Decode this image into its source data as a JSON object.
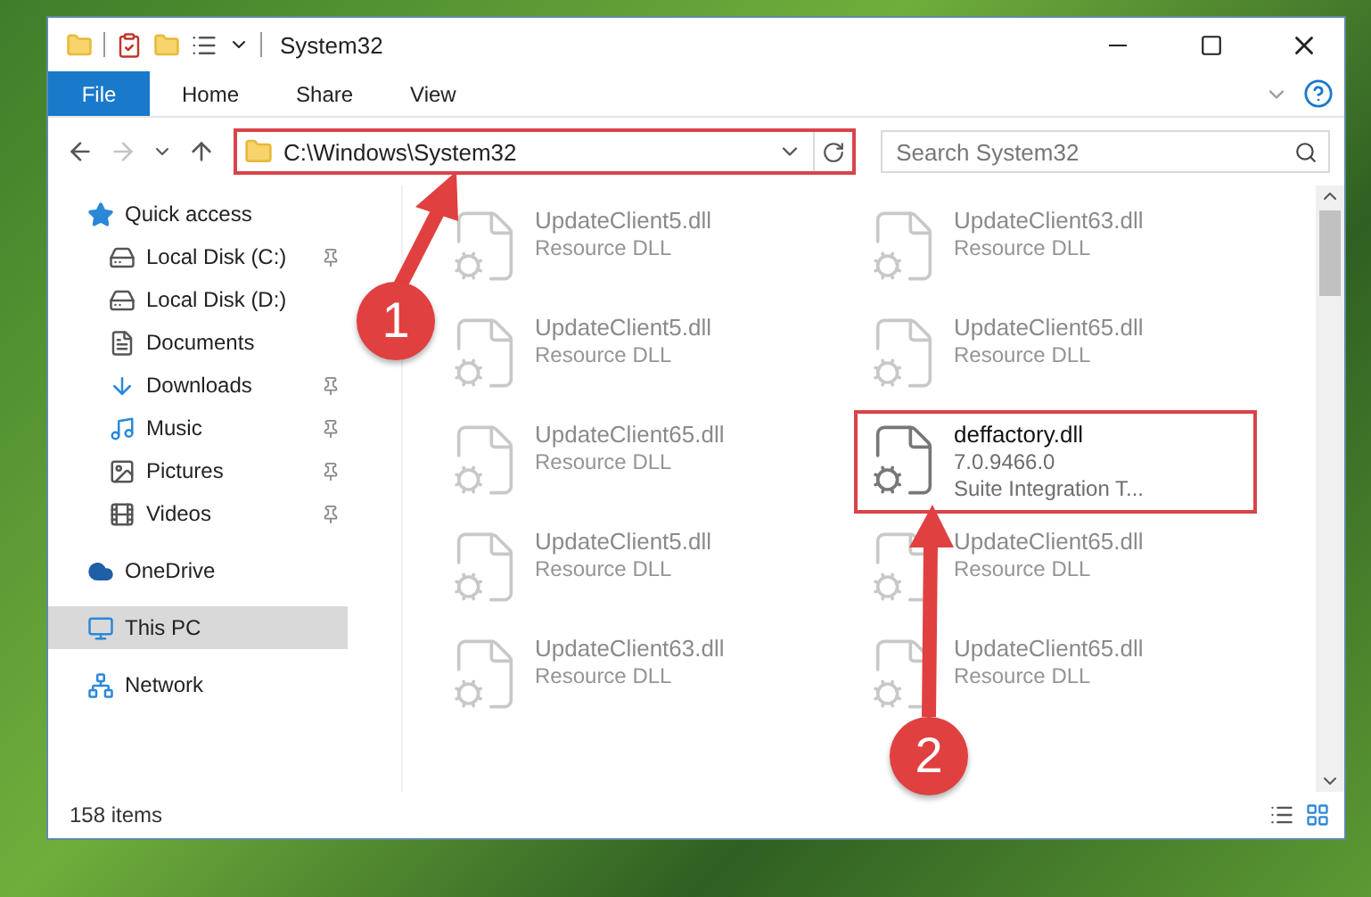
{
  "window": {
    "title": "System32"
  },
  "ribbon_tabs": [
    {
      "label": "File",
      "kind": "file"
    },
    {
      "label": "Home",
      "kind": "tab"
    },
    {
      "label": "Share",
      "kind": "tab"
    },
    {
      "label": "View",
      "kind": "tab"
    }
  ],
  "navigation": {
    "back_disabled": false,
    "forward_disabled": true
  },
  "address": {
    "path": "C:\\Windows\\System32",
    "highlighted": true
  },
  "search": {
    "placeholder": "Search System32"
  },
  "nav": {
    "items": [
      {
        "label": "Quick access",
        "selected": false,
        "children": [
          {
            "label": "Local Disk (C:)",
            "selected": false,
            "pinned": true
          },
          {
            "label": "Local Disk (D:)",
            "selected": false,
            "pinned": false
          },
          {
            "label": "Documents",
            "selected": false,
            "pinned": false
          },
          {
            "label": "Downloads",
            "selected": false,
            "pinned": true
          },
          {
            "label": "Music",
            "selected": false,
            "pinned": true
          },
          {
            "label": "Pictures",
            "selected": false,
            "pinned": true
          },
          {
            "label": "Videos",
            "selected": false,
            "pinned": true
          }
        ]
      },
      {
        "label": "OneDrive",
        "selected": false
      },
      {
        "label": "This PC",
        "selected": true
      },
      {
        "label": "Network",
        "selected": false
      }
    ]
  },
  "files": [
    {
      "name": "UpdateClient5.dll",
      "details": [
        "Resource DLL"
      ],
      "faded": true,
      "highlighted": false
    },
    {
      "name": "UpdateClient63.dll",
      "details": [
        "Resource DLL"
      ],
      "faded": true,
      "highlighted": false
    },
    {
      "name": "UpdateClient5.dll",
      "details": [
        "Resource DLL"
      ],
      "faded": true,
      "highlighted": false
    },
    {
      "name": "UpdateClient65.dll",
      "details": [
        "Resource DLL"
      ],
      "faded": true,
      "highlighted": false
    },
    {
      "name": "UpdateClient65.dll",
      "details": [
        "Resource DLL"
      ],
      "faded": true,
      "highlighted": false
    },
    {
      "name": "deffactory.dll",
      "details": [
        "7.0.9466.0",
        "Suite Integration T..."
      ],
      "faded": false,
      "highlighted": true
    },
    {
      "name": "UpdateClient5.dll",
      "details": [
        "Resource DLL"
      ],
      "faded": true,
      "highlighted": false
    },
    {
      "name": "UpdateClient65.dll",
      "details": [
        "Resource DLL"
      ],
      "faded": true,
      "highlighted": false
    },
    {
      "name": "UpdateClient63.dll",
      "details": [
        "Resource DLL"
      ],
      "faded": true,
      "highlighted": false
    },
    {
      "name": "UpdateClient65.dll",
      "details": [
        "Resource DLL"
      ],
      "faded": true,
      "highlighted": false
    }
  ],
  "status_bar": {
    "item_count": "158 items"
  },
  "annotations": [
    {
      "number": "1"
    },
    {
      "number": "2"
    }
  ]
}
